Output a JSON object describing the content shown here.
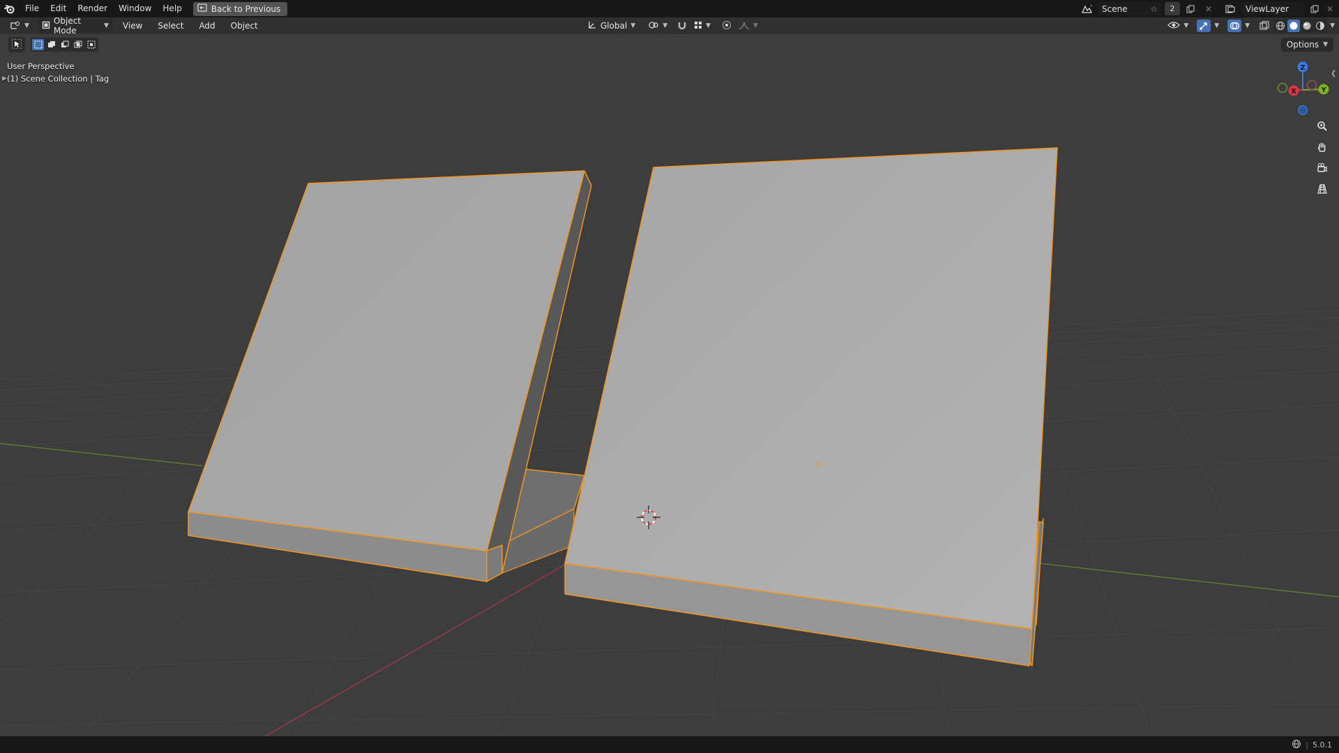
{
  "topbar": {
    "menus": [
      "File",
      "Edit",
      "Render",
      "Window",
      "Help"
    ],
    "back_button": "Back to Previous",
    "scene_name": "Scene",
    "user_count": "2",
    "view_layer": "ViewLayer"
  },
  "viewport_header": {
    "mode": "Object Mode",
    "menus": [
      "View",
      "Select",
      "Add",
      "Object"
    ],
    "transform_orientation": "Global"
  },
  "tools": {
    "options_label": "Options"
  },
  "viewport": {
    "perspective": "User Perspective",
    "collection": "(1) Scene Collection | Tag",
    "gizmo": {
      "x": "X",
      "y": "Y",
      "z": "Z"
    }
  },
  "statusbar": {
    "version": "5.0.1"
  },
  "colors": {
    "selection_outline": "#f2961f",
    "accent_blue": "#4772b3",
    "axis_x": "#d6394a",
    "axis_y": "#7db424",
    "axis_z": "#3c7bde"
  }
}
